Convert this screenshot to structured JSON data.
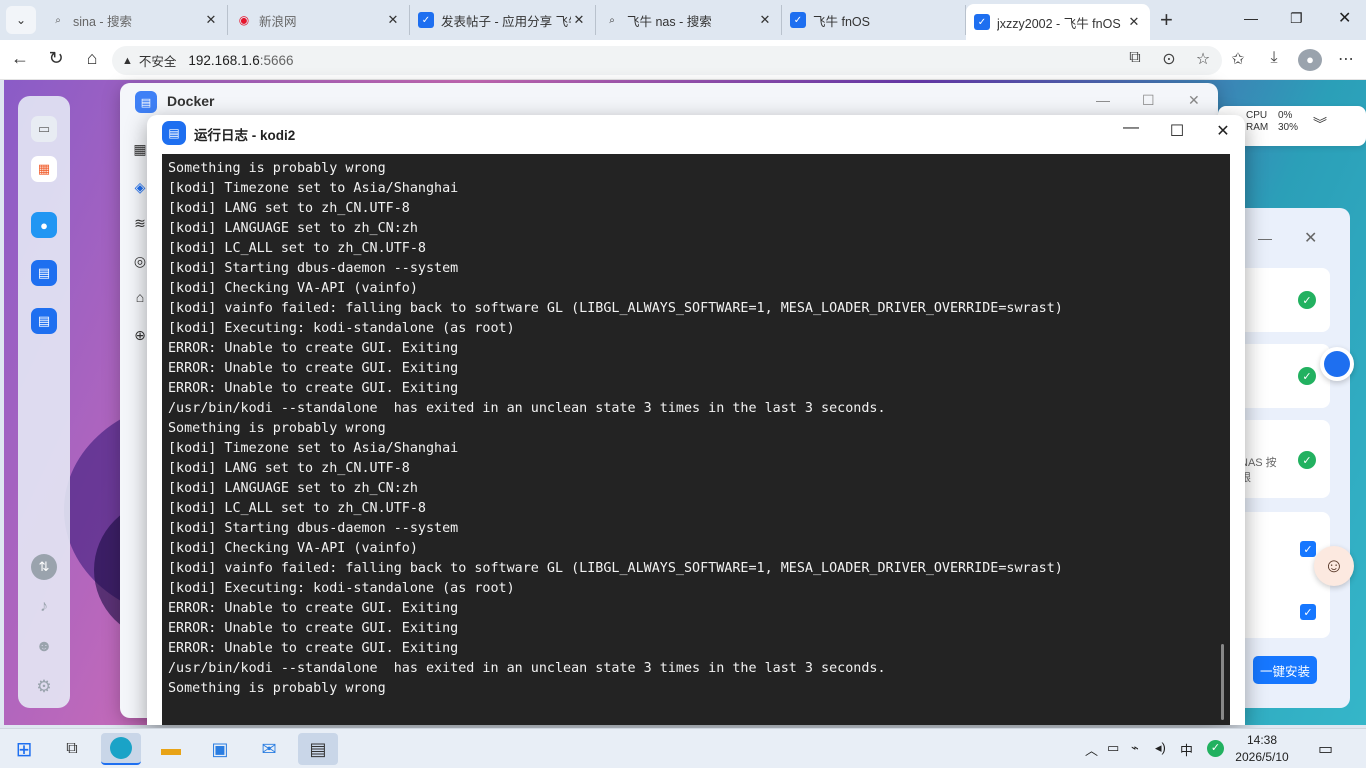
{
  "browser": {
    "tabs": [
      {
        "title": "sina - 搜索",
        "icon": "search-icon"
      },
      {
        "title": "新浪网",
        "icon": "sina-logo-icon"
      },
      {
        "title": "发表帖子 - 应用分享 飞牛",
        "icon": "fnos-logo-icon"
      },
      {
        "title": "飞牛 nas - 搜索",
        "icon": "search-icon"
      },
      {
        "title": "飞牛 fnOS",
        "icon": "fnos-logo-icon"
      },
      {
        "title": "jxzzy2002 - 飞牛 fnOS",
        "icon": "fnos-logo-icon",
        "active": true
      }
    ],
    "security_label": "不安全",
    "url_host": "192.168.1.6",
    "url_port": ":5666"
  },
  "docker_window": {
    "title": "Docker"
  },
  "log_window": {
    "title": "运行日志 - kodi2",
    "lines": [
      "Something is probably wrong",
      "[kodi] Timezone set to Asia/Shanghai",
      "[kodi] LANG set to zh_CN.UTF-8",
      "[kodi] LANGUAGE set to zh_CN:zh",
      "[kodi] LC_ALL set to zh_CN.UTF-8",
      "[kodi] Starting dbus-daemon --system",
      "[kodi] Checking VA-API (vainfo)",
      "[kodi] vainfo failed: falling back to software GL (LIBGL_ALWAYS_SOFTWARE=1, MESA_LOADER_DRIVER_OVERRIDE=swrast)",
      "[kodi] Executing: kodi-standalone (as root)",
      "ERROR: Unable to create GUI. Exiting",
      "ERROR: Unable to create GUI. Exiting",
      "ERROR: Unable to create GUI. Exiting",
      "/usr/bin/kodi --standalone  has exited in an unclean state 3 times in the last 3 seconds.",
      "Something is probably wrong",
      "[kodi] Timezone set to Asia/Shanghai",
      "[kodi] LANG set to zh_CN.UTF-8",
      "[kodi] LANGUAGE set to zh_CN:zh",
      "[kodi] LC_ALL set to zh_CN.UTF-8",
      "[kodi] Starting dbus-daemon --system",
      "[kodi] Checking VA-API (vainfo)",
      "[kodi] vainfo failed: falling back to software GL (LIBGL_ALWAYS_SOFTWARE=1, MESA_LOADER_DRIVER_OVERRIDE=swrast)",
      "[kodi] Executing: kodi-standalone (as root)",
      "ERROR: Unable to create GUI. Exiting",
      "ERROR: Unable to create GUI. Exiting",
      "ERROR: Unable to create GUI. Exiting",
      "/usr/bin/kodi --standalone  has exited in an unclean state 3 times in the last 3 seconds.",
      "Something is probably wrong"
    ]
  },
  "resource_panel": {
    "cpu_label": "CPU",
    "ram_label": "RAM",
    "cpu_value": "0%",
    "ram_value": "30%"
  },
  "side_panel": {
    "fragment_text_1": "NAS 按",
    "fragment_text_2": "限",
    "install_button": "一键安装"
  },
  "taskbar": {
    "time": "14:38",
    "date": "2026/5/10",
    "ime": "中"
  },
  "colors": {
    "accent": "#1677ff",
    "terminal_bg": "#232323",
    "success": "#22b160"
  }
}
